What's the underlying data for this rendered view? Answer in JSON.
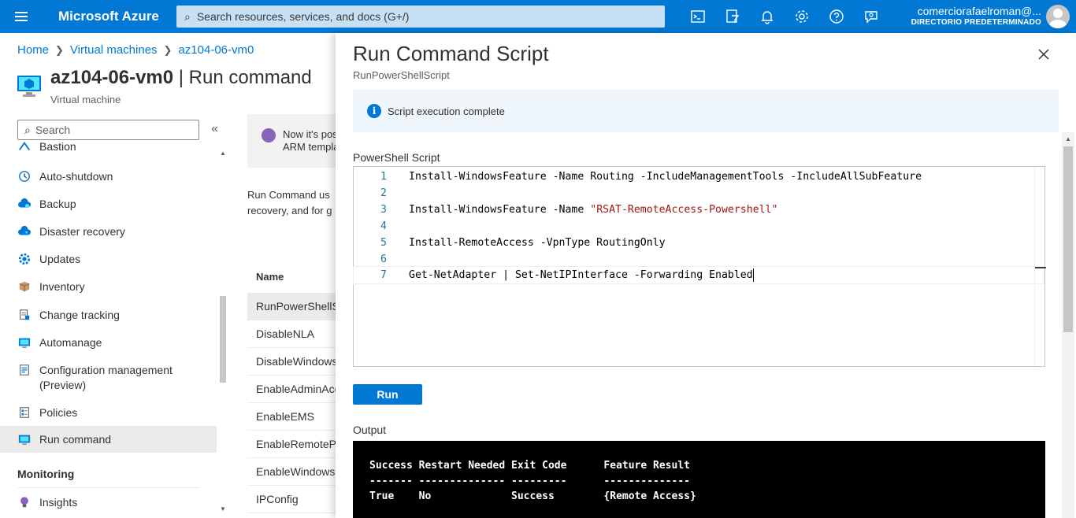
{
  "topbar": {
    "brand": "Microsoft Azure",
    "search_placeholder": "Search resources, services, and docs (G+/)",
    "icons": [
      "cloud-shell-icon",
      "directory-filter-icon",
      "notifications-icon",
      "settings-icon",
      "help-icon",
      "feedback-icon"
    ],
    "account_name": "comerciorafaelroman@...",
    "account_directory": "DIRECTORIO PREDETERMINADO"
  },
  "breadcrumb": [
    "Home",
    "Virtual machines",
    "az104-06-vm0"
  ],
  "page": {
    "title_bold": "az104-06-vm0",
    "title_rest": " | Run command",
    "subtitle": "Virtual machine"
  },
  "sidebar": {
    "search_placeholder": "Search",
    "items": [
      {
        "label": "Bastion",
        "icon": "bastion-icon"
      },
      {
        "label": "Auto-shutdown",
        "icon": "clock-icon"
      },
      {
        "label": "Backup",
        "icon": "backup-icon"
      },
      {
        "label": "Disaster recovery",
        "icon": "cloud-icon"
      },
      {
        "label": "Updates",
        "icon": "gear-icon"
      },
      {
        "label": "Inventory",
        "icon": "box-icon"
      },
      {
        "label": "Change tracking",
        "icon": "document-icon"
      },
      {
        "label": "Automanage",
        "icon": "automanage-icon"
      },
      {
        "label": "Configuration management",
        "label2": "(Preview)",
        "icon": "config-icon"
      },
      {
        "label": "Policies",
        "icon": "policy-icon"
      },
      {
        "label": "Run command",
        "icon": "run-command-icon",
        "active": true
      }
    ],
    "section_monitoring": "Monitoring",
    "insights": "Insights"
  },
  "middle": {
    "notice_line1": "Now it's pos",
    "notice_line2": "ARM templa",
    "desc_line1": "Run Command us",
    "desc_line2": "recovery, and for g",
    "table_header": "Name",
    "commands": [
      "RunPowerShellS",
      "DisableNLA",
      "DisableWindows",
      "EnableAdminAcc",
      "EnableEMS",
      "EnableRemotePS",
      "EnableWindows",
      "IPConfig"
    ]
  },
  "blade": {
    "title": "Run Command Script",
    "subtitle": "RunPowerShellScript",
    "info": "Script execution complete",
    "script_label": "PowerShell Script",
    "lines": [
      {
        "n": "1",
        "code": "Install-WindowsFeature -Name Routing -IncludeManagementTools -IncludeAllSubFeature"
      },
      {
        "n": "2",
        "code": ""
      },
      {
        "n": "3",
        "code": "Install-WindowsFeature -Name ",
        "str": "\"RSAT-RemoteAccess-Powershell\""
      },
      {
        "n": "4",
        "code": ""
      },
      {
        "n": "5",
        "code": "Install-RemoteAccess -VpnType RoutingOnly"
      },
      {
        "n": "6",
        "code": ""
      },
      {
        "n": "7",
        "code": "Get-NetAdapter | Set-NetIPInterface -Forwarding Enabled"
      }
    ],
    "run_label": "Run",
    "output_label": "Output",
    "output_text": "Success Restart Needed Exit Code      Feature Result\n------- -------------- ---------      --------------\nTrue    No             Success        {Remote Access}"
  },
  "colors": {
    "accent": "#0078d4",
    "console_bg": "#000000",
    "string": "#a31515"
  }
}
